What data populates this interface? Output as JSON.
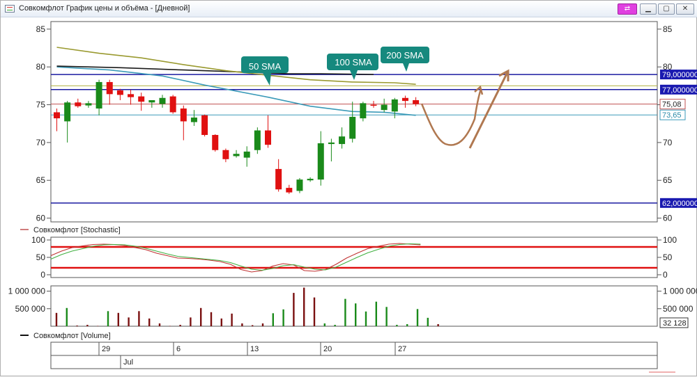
{
  "window": {
    "title": "Совкомфлот График цены и объёма - [Дневной]",
    "buttons": {
      "link": "⇄",
      "minimize": "▁",
      "maximize": "▢",
      "close": "✕"
    }
  },
  "colors": {
    "up": "#1a8a1a",
    "down": "#e01010",
    "sma50": "#3a9ab8",
    "sma100": "#1a1a1a",
    "sma200": "#9a9a30",
    "level": "#1a1aa0",
    "drawing": "#b07850",
    "stoch_k": "#c03030",
    "stoch_d": "#40b040",
    "stoch_level": "#e01010"
  },
  "chart_data": [
    {
      "type": "candlestick",
      "title": "",
      "ylim": [
        59.5,
        86
      ],
      "yticks": [
        "85",
        "80",
        "75",
        "70",
        "65",
        "60"
      ],
      "candles": [
        {
          "o": 74.0,
          "h": 74.5,
          "l": 71.5,
          "c": 73.2
        },
        {
          "o": 72.8,
          "h": 75.5,
          "l": 70.0,
          "c": 75.3
        },
        {
          "o": 75.3,
          "h": 75.8,
          "l": 74.6,
          "c": 74.8
        },
        {
          "o": 74.9,
          "h": 75.5,
          "l": 74.6,
          "c": 75.2
        },
        {
          "o": 74.5,
          "h": 78.3,
          "l": 73.6,
          "c": 78.0
        },
        {
          "o": 78.0,
          "h": 78.3,
          "l": 75.0,
          "c": 76.4
        },
        {
          "o": 76.9,
          "h": 77.1,
          "l": 75.6,
          "c": 76.3
        },
        {
          "o": 76.4,
          "h": 77.0,
          "l": 75.0,
          "c": 76.0
        },
        {
          "o": 76.1,
          "h": 76.6,
          "l": 74.2,
          "c": 75.4
        },
        {
          "o": 75.3,
          "h": 75.6,
          "l": 74.6,
          "c": 75.6
        },
        {
          "o": 75.1,
          "h": 76.3,
          "l": 74.6,
          "c": 75.9
        },
        {
          "o": 76.1,
          "h": 76.3,
          "l": 73.8,
          "c": 74.0
        },
        {
          "o": 74.5,
          "h": 74.9,
          "l": 70.3,
          "c": 72.8
        },
        {
          "o": 72.7,
          "h": 74.3,
          "l": 72.2,
          "c": 73.3
        },
        {
          "o": 73.6,
          "h": 73.7,
          "l": 70.8,
          "c": 71.0
        },
        {
          "o": 71.0,
          "h": 71.1,
          "l": 68.8,
          "c": 69.0
        },
        {
          "o": 69.0,
          "h": 69.2,
          "l": 67.4,
          "c": 67.8
        },
        {
          "o": 68.2,
          "h": 69.0,
          "l": 68.0,
          "c": 68.5
        },
        {
          "o": 68.0,
          "h": 69.5,
          "l": 66.8,
          "c": 68.8
        },
        {
          "o": 69.0,
          "h": 72.0,
          "l": 68.5,
          "c": 71.6
        },
        {
          "o": 71.6,
          "h": 73.6,
          "l": 69.3,
          "c": 69.7
        },
        {
          "o": 66.5,
          "h": 67.8,
          "l": 63.5,
          "c": 63.8
        },
        {
          "o": 64.0,
          "h": 64.4,
          "l": 63.2,
          "c": 63.4
        },
        {
          "o": 63.6,
          "h": 65.3,
          "l": 63.3,
          "c": 65.1
        },
        {
          "o": 65.0,
          "h": 65.4,
          "l": 64.8,
          "c": 65.2
        },
        {
          "o": 65.1,
          "h": 71.5,
          "l": 64.3,
          "c": 69.9
        },
        {
          "o": 69.8,
          "h": 70.5,
          "l": 67.5,
          "c": 70.0
        },
        {
          "o": 69.8,
          "h": 72.0,
          "l": 69.2,
          "c": 70.8
        },
        {
          "o": 70.5,
          "h": 75.4,
          "l": 70.0,
          "c": 73.4
        },
        {
          "o": 73.2,
          "h": 75.4,
          "l": 72.8,
          "c": 75.2
        },
        {
          "o": 75.0,
          "h": 75.5,
          "l": 74.6,
          "c": 74.9
        },
        {
          "o": 74.3,
          "h": 75.8,
          "l": 74.0,
          "c": 75.0
        },
        {
          "o": 74.1,
          "h": 75.9,
          "l": 73.2,
          "c": 75.7
        },
        {
          "o": 75.9,
          "h": 76.2,
          "l": 74.6,
          "c": 75.5
        },
        {
          "o": 75.6,
          "h": 76.0,
          "l": 74.8,
          "c": 75.1
        }
      ],
      "sma": [
        {
          "label": "50 SMA",
          "points": [
            [
              0,
              80.0
            ],
            [
              5,
              79.6
            ],
            [
              10,
              78.8
            ],
            [
              14,
              77.6
            ],
            [
              20,
              76.0
            ],
            [
              24,
              74.8
            ],
            [
              28,
              74.1
            ],
            [
              31,
              74.0
            ],
            [
              34,
              73.6
            ]
          ]
        },
        {
          "label": "100 SMA",
          "points": [
            [
              0,
              80.1
            ],
            [
              6,
              79.9
            ],
            [
              12,
              79.6
            ],
            [
              16,
              79.4
            ],
            [
              22,
              79.1
            ],
            [
              25,
              79.1
            ],
            [
              30,
              79.0
            ]
          ]
        },
        {
          "label": "200 SMA",
          "points": [
            [
              0,
              82.6
            ],
            [
              4,
              81.8
            ],
            [
              8,
              81.2
            ],
            [
              12,
              80.3
            ],
            [
              16,
              79.5
            ],
            [
              20,
              78.9
            ],
            [
              24,
              78.3
            ],
            [
              28,
              78.0
            ],
            [
              32,
              77.9
            ],
            [
              34,
              77.7
            ]
          ]
        }
      ],
      "levels": [
        "79,000000",
        "77,000000",
        "62,000000"
      ],
      "level_values": [
        79.0,
        77.0,
        62.0
      ],
      "extra_lines": [
        {
          "value": 77.5,
          "color": "#b0b040"
        },
        {
          "value": 75.08,
          "color": "#c05050"
        },
        {
          "value": 73.65,
          "color": "#3a9ab8"
        }
      ],
      "price_labels": [
        {
          "text": "75,08",
          "value": 75.08
        },
        {
          "text": "73,65",
          "value": 73.65
        }
      ],
      "callouts": [
        "50 SMA",
        "100 SMA",
        "200 SMA"
      ]
    },
    {
      "type": "line",
      "title": "Совкомфлот [Stochastic]",
      "ylim": [
        -8,
        108
      ],
      "yticks": [
        "100",
        "50",
        "0"
      ],
      "levels": [
        80,
        20
      ],
      "series": [
        {
          "name": "k",
          "values": [
            55,
            68,
            78,
            83,
            87,
            88,
            87,
            84,
            78,
            72,
            62,
            55,
            48,
            47,
            45,
            42,
            38,
            30,
            15,
            8,
            12,
            25,
            32,
            28,
            12,
            10,
            15,
            30,
            48,
            62,
            75,
            82,
            88,
            90,
            88,
            86
          ]
        },
        {
          "name": "d",
          "values": [
            45,
            58,
            68,
            75,
            82,
            86,
            87,
            86,
            82,
            76,
            68,
            60,
            53,
            50,
            47,
            44,
            41,
            35,
            25,
            16,
            13,
            18,
            26,
            29,
            22,
            16,
            14,
            22,
            36,
            50,
            63,
            73,
            82,
            87,
            89,
            88
          ]
        }
      ]
    },
    {
      "type": "bar",
      "title": "Совкомфлот [Volume]",
      "ylim": [
        0,
        1150000
      ],
      "yticks": [
        "1 000 000",
        "500 000"
      ],
      "last_value": "32 128",
      "values": [
        380000,
        520000,
        20000,
        40000,
        10000,
        430000,
        380000,
        250000,
        430000,
        220000,
        80000,
        10000,
        40000,
        250000,
        520000,
        400000,
        220000,
        360000,
        80000,
        30000,
        80000,
        370000,
        480000,
        950000,
        1100000,
        820000,
        80000,
        40000,
        780000,
        650000,
        420000,
        700000,
        550000,
        40000,
        60000,
        490000,
        240000,
        60000
      ],
      "directions": [
        "down",
        "up",
        "down",
        "down",
        "down",
        "up",
        "down",
        "down",
        "down",
        "down",
        "down",
        "down",
        "down",
        "down",
        "down",
        "down",
        "down",
        "down",
        "down",
        "down",
        "down",
        "up",
        "up",
        "down",
        "down",
        "down",
        "up",
        "up",
        "up",
        "up",
        "up",
        "up",
        "up",
        "up",
        "up",
        "up",
        "up",
        "down"
      ]
    }
  ],
  "x_axis": {
    "days": [
      "29",
      "6",
      "13",
      "20",
      "27"
    ],
    "month": "Jul"
  }
}
